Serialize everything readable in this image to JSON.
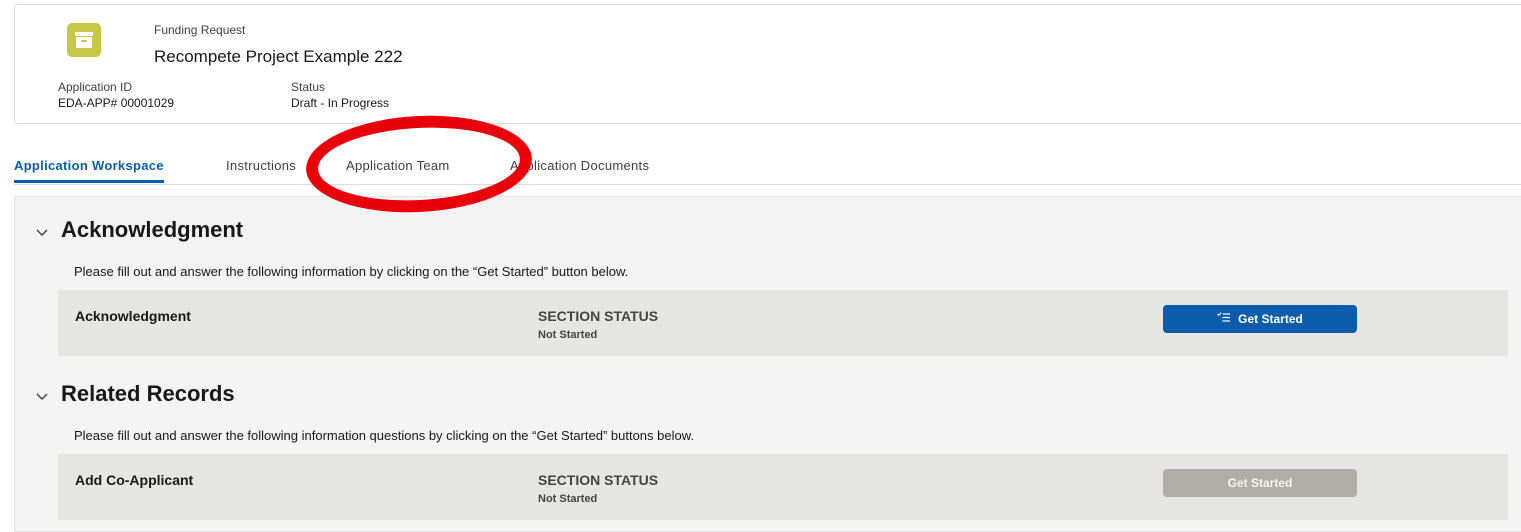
{
  "header": {
    "object_type": "Funding Request",
    "title": "Recompete Project Example 222",
    "icon": "archive-box-icon",
    "icon_color": "#c6c848",
    "fields": [
      {
        "label": "Application ID",
        "value": "EDA-APP# 00001029"
      },
      {
        "label": "Status",
        "value": "Draft - In Progress"
      }
    ]
  },
  "tabs": [
    {
      "label": "Application Workspace",
      "active": true
    },
    {
      "label": "Instructions",
      "active": false
    },
    {
      "label": "Application Team",
      "active": false
    },
    {
      "label": "Application Documents",
      "active": false
    }
  ],
  "sections": [
    {
      "title": "Acknowledgment",
      "description": "Please fill out and answer the following information by clicking on the “Get Started” button below.",
      "rows": [
        {
          "name": "Acknowledgment",
          "status_label": "SECTION STATUS",
          "status_value": "Not Started",
          "button_label": "Get Started",
          "button_enabled": true
        }
      ]
    },
    {
      "title": "Related Records",
      "description": "Please fill out and answer the following information questions by clicking on the “Get Started” buttons below.",
      "rows": [
        {
          "name": "Add Co-Applicant",
          "status_label": "SECTION STATUS",
          "status_value": "Not Started",
          "button_label": "Get Started",
          "button_enabled": false
        }
      ]
    }
  ],
  "colors": {
    "accent": "#0b5cab",
    "annotation": "#e8000b",
    "disabled_button": "#aeaea6"
  }
}
